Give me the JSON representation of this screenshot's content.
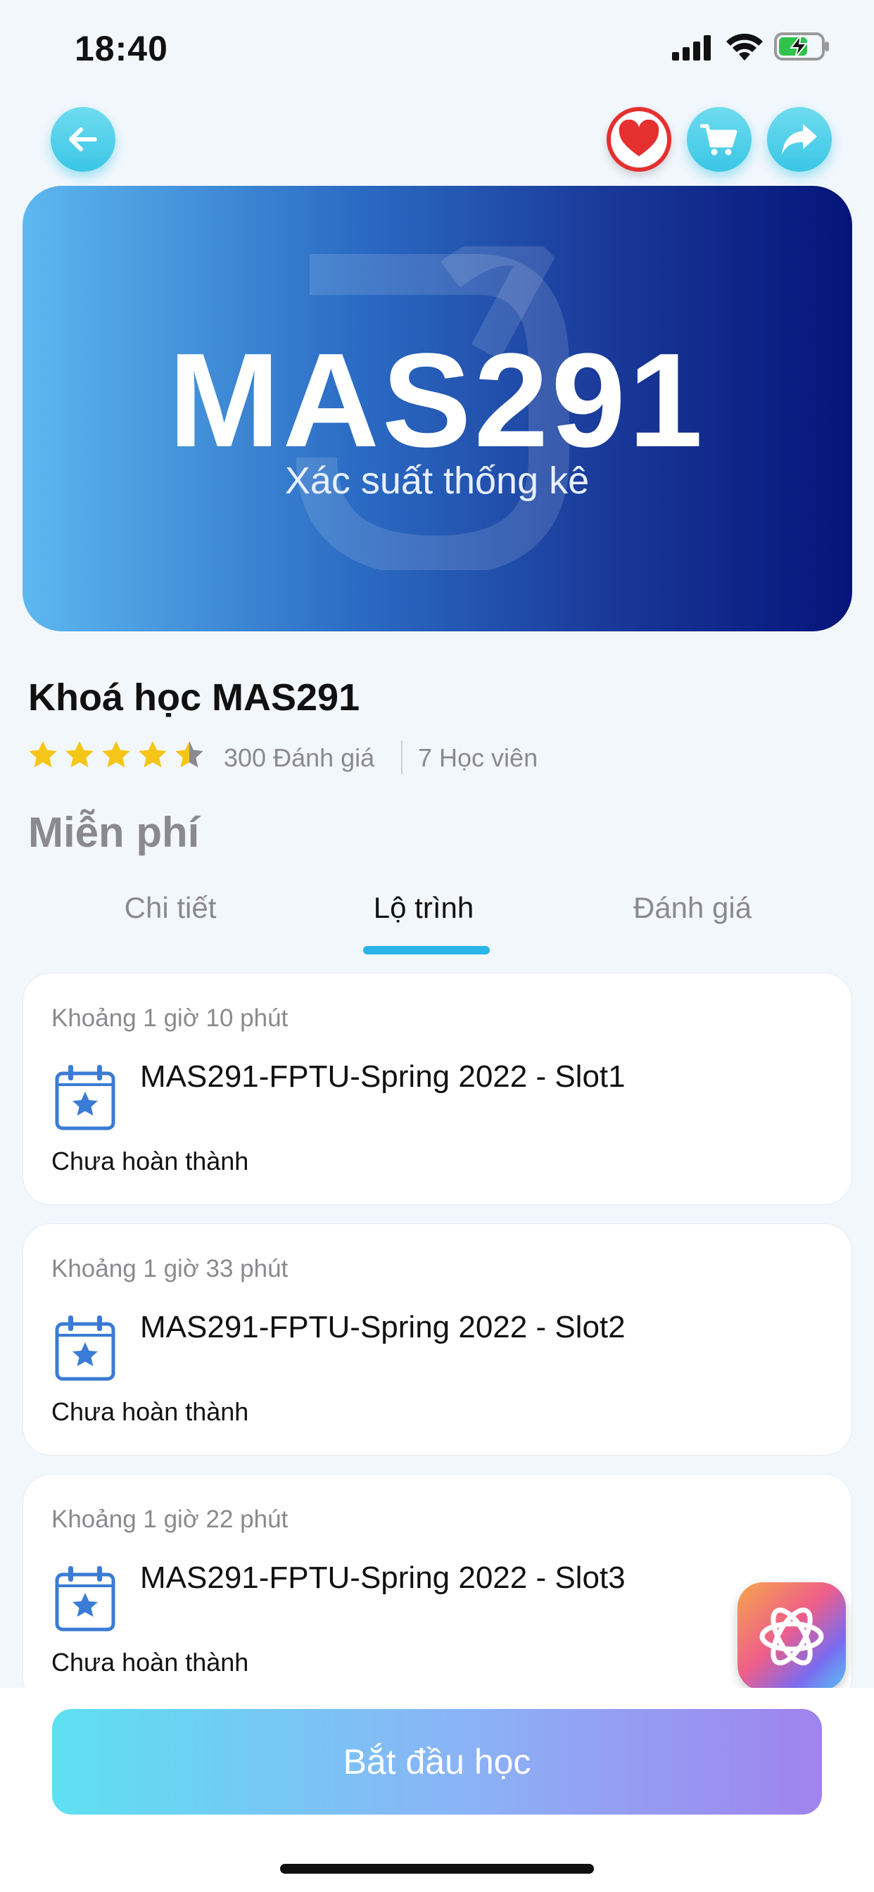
{
  "status_bar": {
    "time": "18:40"
  },
  "banner": {
    "title": "MAS291",
    "subtitle": "Xác suất thống kê"
  },
  "course": {
    "title": "Khoá học MAS291",
    "rating": 4.5,
    "reviews": "300 Đánh giá",
    "students": "7 Học viên",
    "price": "Miễn phí"
  },
  "tabs": [
    {
      "label": "Chi tiết",
      "active": false
    },
    {
      "label": "Lộ trình",
      "active": true
    },
    {
      "label": "Đánh giá",
      "active": false
    }
  ],
  "lessons": [
    {
      "duration": "Khoảng 1 giờ 10 phút",
      "title": "MAS291-FPTU-Spring 2022 - Slot1",
      "status": "Chưa hoàn thành"
    },
    {
      "duration": "Khoảng 1 giờ 33 phút",
      "title": "MAS291-FPTU-Spring 2022 - Slot2",
      "status": "Chưa hoàn thành"
    },
    {
      "duration": "Khoảng 1 giờ 22 phút",
      "title": "MAS291-FPTU-Spring 2022 - Slot3",
      "status": "Chưa hoàn thành"
    }
  ],
  "cta": {
    "start_label": "Bắt đầu học"
  },
  "colors": {
    "accent": "#2ab4e8",
    "heart": "#e53030",
    "star": "#f5c518",
    "calendar": "#3a7bd5"
  },
  "icons": [
    "back-arrow-icon",
    "heart-icon",
    "cart-icon",
    "share-icon",
    "star-icon",
    "calendar-star-icon",
    "ai-assistant-icon"
  ]
}
